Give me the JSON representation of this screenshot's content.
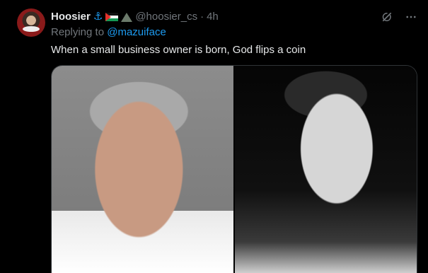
{
  "tweet": {
    "display_name": "Hoosier",
    "anchor_emoji": "⚓",
    "handle": "@hoosier_cs",
    "separator": "·",
    "timestamp": "4h",
    "reply_prefix": "Replying to ",
    "reply_to": "@mazuiface",
    "text": "When a small business owner is born, God flips a coin"
  },
  "colors": {
    "background": "#000000",
    "text": "#e7e9ea",
    "muted": "#71767b",
    "accent": "#1d9bf0"
  },
  "icons": {
    "grok": "grok-icon",
    "more": "more-icon"
  }
}
